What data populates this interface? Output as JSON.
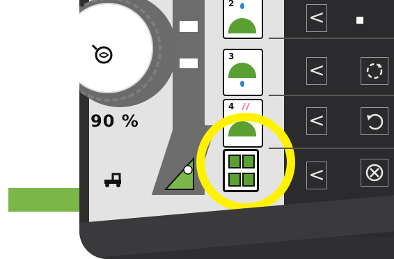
{
  "gauge": {
    "percent_text": "90 %",
    "icon": "turbine-icon"
  },
  "vertical_bar": {
    "indicator_icon": "level-triangle-icon"
  },
  "left_bottom_icon": "tractor-icon",
  "stack_buttons": [
    {
      "number": "2",
      "icon": "dome-drop-top-icon"
    },
    {
      "number": "3",
      "icon": "dome-drop-bottom-icon"
    },
    {
      "number": "4",
      "icon": "dome-heat-icon"
    }
  ],
  "grid_button": {
    "icon": "four-sections-icon",
    "highlighted": true
  },
  "highlight_color": "#fff200",
  "pointer_arrow_color": "#7ab648",
  "right_panel": {
    "chevrons": [
      "<",
      "<",
      "<",
      "<"
    ],
    "side_buttons": [
      {
        "icon": "stop-icon"
      },
      {
        "icon": "rotate-dashed-icon"
      },
      {
        "icon": "rotate-icon"
      },
      {
        "icon": "cancel-circle-icon"
      }
    ]
  },
  "colors": {
    "dome_green": "#5aa033",
    "drop_blue": "#2f83c9",
    "panel_dark": "#2b2b2d"
  }
}
